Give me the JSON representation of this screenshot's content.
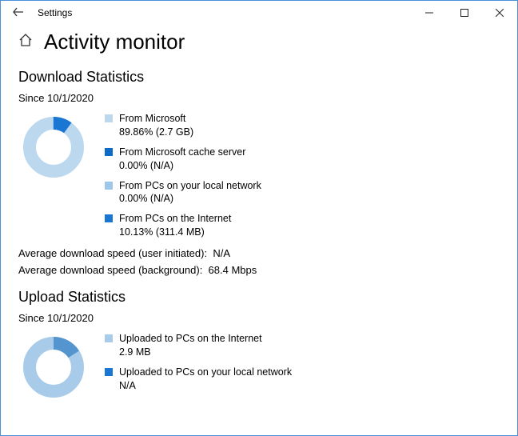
{
  "window": {
    "title": "Settings"
  },
  "page": {
    "title": "Activity monitor"
  },
  "download": {
    "section_title": "Download Statistics",
    "since": "Since 10/1/2020",
    "items": [
      {
        "label": "From Microsoft",
        "value": "89.86%  (2.7 GB)",
        "color": "#bcd8ef"
      },
      {
        "label": "From Microsoft cache server",
        "value": "0.00%  (N/A)",
        "color": "#0b69c7"
      },
      {
        "label": "From PCs on your local network",
        "value": "0.00%  (N/A)",
        "color": "#9dc6e8"
      },
      {
        "label": "From PCs on the Internet",
        "value": "10.13%  (311.4 MB)",
        "color": "#1976d2"
      }
    ],
    "avg_user_label": "Average download speed (user initiated):",
    "avg_user_value": "N/A",
    "avg_bg_label": "Average download speed (background):",
    "avg_bg_value": "68.4 Mbps"
  },
  "upload": {
    "section_title": "Upload Statistics",
    "since": "Since 10/1/2020",
    "items": [
      {
        "label": "Uploaded to PCs on the Internet",
        "value": "2.9 MB",
        "color": "#a7cbe9"
      },
      {
        "label": "Uploaded to PCs on your local network",
        "value": "N/A",
        "color": "#1976d2"
      }
    ]
  },
  "chart_data": [
    {
      "type": "pie",
      "title": "Download sources",
      "categories": [
        "From Microsoft",
        "From Microsoft cache server",
        "From PCs on your local network",
        "From PCs on the Internet"
      ],
      "values": [
        89.86,
        0.0,
        0.0,
        10.13
      ],
      "colors": [
        "#bcd8ef",
        "#0b69c7",
        "#9dc6e8",
        "#1976d2"
      ]
    },
    {
      "type": "pie",
      "title": "Upload destinations",
      "categories": [
        "Uploaded to PCs on the Internet",
        "Uploaded to PCs on your local network"
      ],
      "values": [
        100,
        0
      ],
      "colors": [
        "#a7cbe9",
        "#1976d2"
      ]
    }
  ]
}
